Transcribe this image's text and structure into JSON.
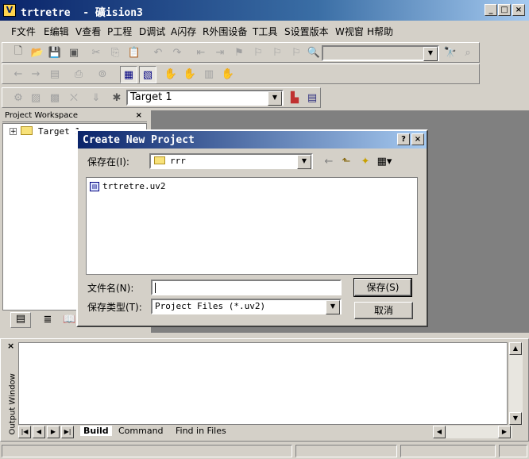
{
  "window": {
    "title": "trtretre  - 礦ision3"
  },
  "menu": [
    "F文件",
    "E编辑",
    "V查看",
    "P工程",
    "D调试",
    "A闪存",
    "R外围设备",
    "T工具",
    "S设置版本",
    "W视窗",
    "H帮助"
  ],
  "toolbar": {
    "target": "Target 1"
  },
  "workspace": {
    "title": "Project Workspace",
    "close": "×",
    "tree_item": "Target 1"
  },
  "output": {
    "title": "Output Window",
    "tabs": [
      "Build",
      "Command",
      "Find in Files"
    ]
  },
  "dialog": {
    "title": "Create New Project",
    "save_in_label": "保存在(I):",
    "save_in_value": "rrr",
    "file_item": "trtretre.uv2",
    "filename_label": "文件名(N):",
    "filename_value": "",
    "filetype_label": "保存类型(T):",
    "filetype_value": "Project Files (*.uv2)",
    "save_button": "保存(S)",
    "cancel_button": "取消"
  }
}
